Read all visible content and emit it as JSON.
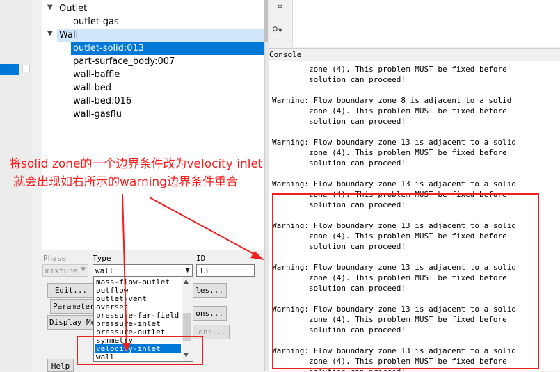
{
  "tree": {
    "outlet_label": "Outlet",
    "outlet_children": [
      "outlet-gas"
    ],
    "wall_label": "Wall",
    "wall_children": [
      "outlet-solid:013",
      "part-surface_body:007",
      "wall-baffle",
      "wall-bed",
      "wall-bed:016",
      "wall-gasflu"
    ]
  },
  "form": {
    "phase_label": "Phase",
    "phase_value": "mixture",
    "type_label": "Type",
    "type_value": "wall",
    "id_label": "ID",
    "id_value": "13",
    "buttons": {
      "edit": "Edit...",
      "parameters": "Parameters",
      "display_mesh": "Display Mesh",
      "profiles": "les...",
      "operating": "ons...",
      "periodic": "ons...",
      "help": "Help"
    },
    "type_options": [
      "mass-flow-outlet",
      "outflow",
      "outlet-vent",
      "overset",
      "pressure-far-field",
      "pressure-inlet",
      "pressure-outlet",
      "symmetry",
      "velocity-inlet",
      "wall"
    ],
    "type_options_selected": "velocity-inlet"
  },
  "right_panel": {
    "console_title": "Console",
    "toolbar": {
      "expand_glyph": "»",
      "tool_glyph": "⚲▾"
    }
  },
  "console": {
    "lines": [
      "        zone (4). This problem MUST be fixed before",
      "        solution can proceed!",
      "",
      "Warning: Flow boundary zone 8 is adjacent to a solid",
      "        zone (4). This problem MUST be fixed before",
      "        solution can proceed!",
      "",
      "Warning: Flow boundary zone 13 is adjacent to a solid",
      "        zone (4). This problem MUST be fixed before",
      "        solution can proceed!",
      "",
      "Warning: Flow boundary zone 13 is adjacent to a solid",
      "        zone (4). This problem MUST be fixed before",
      "        solution can proceed!",
      "",
      "Warning: Flow boundary zone 13 is adjacent to a solid",
      "        zone (4). This problem MUST be fixed before",
      "        solution can proceed!",
      "",
      "Warning: Flow boundary zone 13 is adjacent to a solid",
      "        zone (4). This problem MUST be fixed before",
      "        solution can proceed!",
      "",
      "Warning: Flow boundary zone 13 is adjacent to a solid",
      "        zone (4). This problem MUST be fixed before",
      "        solution can proceed!",
      "",
      "Warning: Flow boundary zone 13 is adjacent to a solid",
      "        zone (4). This problem MUST be fixed before",
      "        solution can proceed!"
    ]
  },
  "annotation": {
    "line1": "将solid zone的一个边界条件改为velocity inlet",
    "line2": "就会出现如右所示的warning边界条件重合",
    "color": "#ff1a1a"
  }
}
